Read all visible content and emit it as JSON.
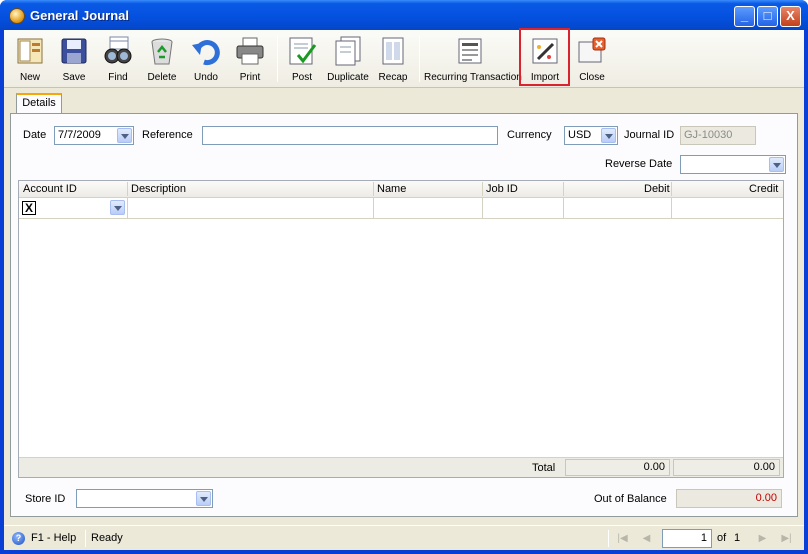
{
  "window": {
    "title": "General Journal",
    "controls": {
      "minimize": "_",
      "maximize": "□",
      "close": "X"
    }
  },
  "toolbar": {
    "new": "New",
    "save": "Save",
    "find": "Find",
    "delete": "Delete",
    "undo": "Undo",
    "print": "Print",
    "post": "Post",
    "duplicate": "Duplicate",
    "recap": "Recap",
    "recurring": "Recurring Transaction",
    "import": "Import",
    "close": "Close"
  },
  "tabs": {
    "details": "Details"
  },
  "form": {
    "date_label": "Date",
    "date_value": "7/7/2009",
    "reference_label": "Reference",
    "reference_value": "",
    "currency_label": "Currency",
    "currency_value": "USD",
    "journal_id_label": "Journal ID",
    "journal_id_value": "GJ-10030",
    "reverse_date_label": "Reverse Date",
    "reverse_date_value": ""
  },
  "grid": {
    "columns": [
      "Account ID",
      "Description",
      "Name",
      "Job ID",
      "Debit",
      "Credit"
    ],
    "row_delete_glyph": "X",
    "total_label": "Total",
    "total_debit": "0.00",
    "total_credit": "0.00"
  },
  "footer": {
    "store_id_label": "Store ID",
    "store_id_value": "",
    "out_of_balance_label": "Out of Balance",
    "out_of_balance_value": "0.00"
  },
  "status": {
    "help": "F1 - Help",
    "state": "Ready",
    "page": "1",
    "of_label": "of",
    "total_pages": "1"
  },
  "colors": {
    "titlebar": "#0450de",
    "highlight": "#d9232e",
    "out_of_balance": "#c00000"
  }
}
